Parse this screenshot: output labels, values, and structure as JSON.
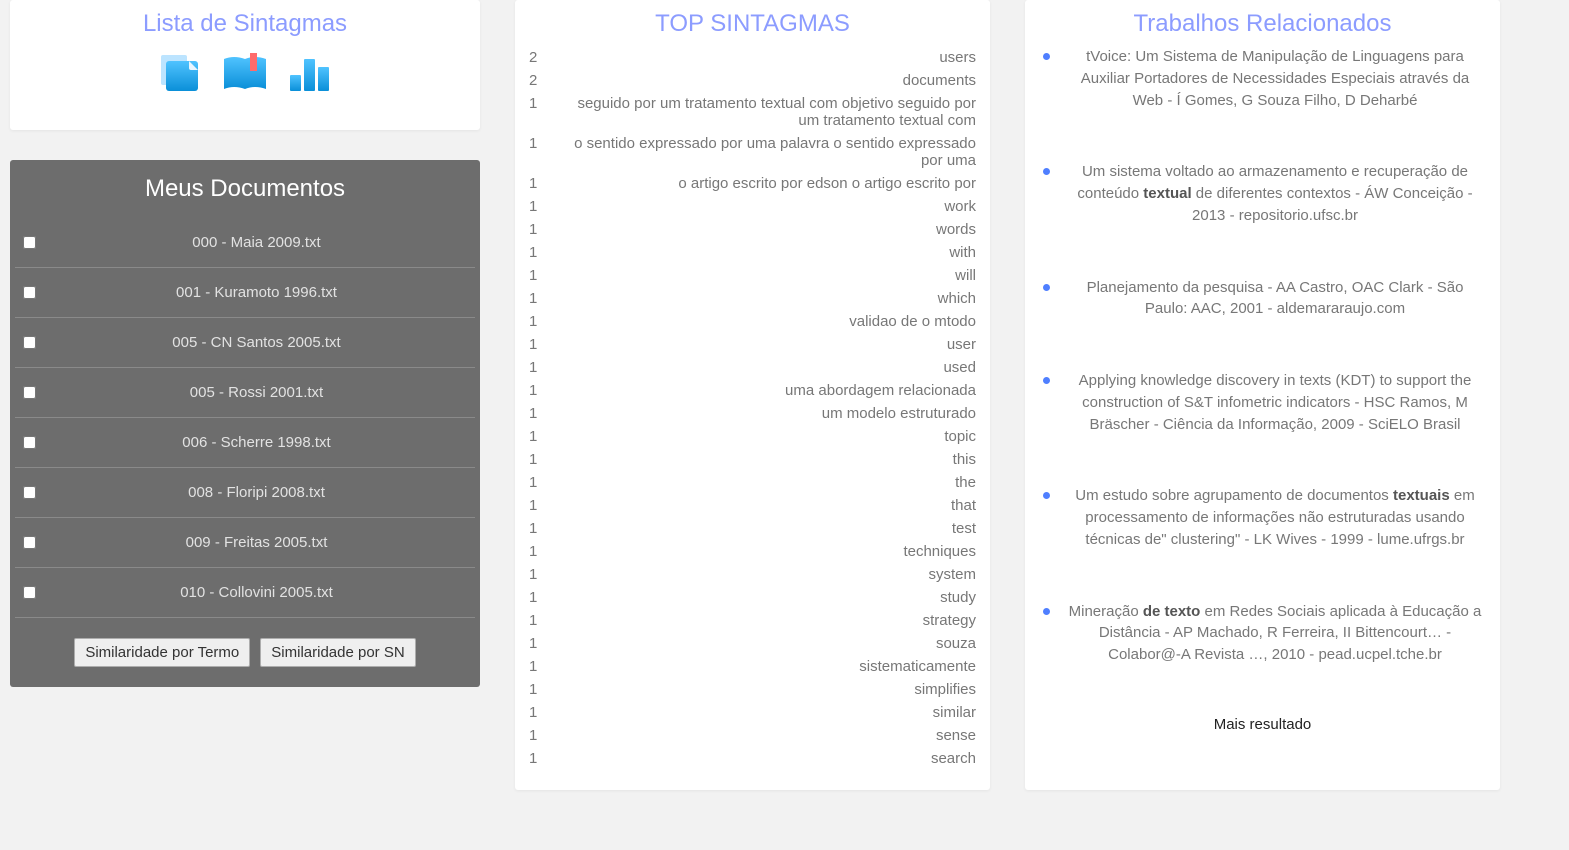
{
  "left": {
    "sintagmas_title": "Lista de Sintagmas",
    "docs_title": "Meus Documentos",
    "documents": [
      "000 - Maia 2009.txt",
      "001 - Kuramoto 1996.txt",
      "005 - CN Santos 2005.txt",
      "005 - Rossi 2001.txt",
      "006 - Scherre 1998.txt",
      "008 - Floripi 2008.txt",
      "009 - Freitas 2005.txt",
      "010 - Collovini 2005.txt"
    ],
    "btn_term": "Similaridade por Termo",
    "btn_sn": "Similaridade por SN"
  },
  "mid": {
    "title": "TOP SINTAGMAS",
    "rows": [
      {
        "count": "2",
        "term": "users"
      },
      {
        "count": "2",
        "term": "documents"
      },
      {
        "count": "1",
        "term": "seguido por um tratamento textual com objetivo seguido por um tratamento textual com"
      },
      {
        "count": "1",
        "term": "o sentido expressado por uma palavra o sentido expressado por uma"
      },
      {
        "count": "1",
        "term": "o artigo escrito por edson o artigo escrito por"
      },
      {
        "count": "1",
        "term": "work"
      },
      {
        "count": "1",
        "term": "words"
      },
      {
        "count": "1",
        "term": "with"
      },
      {
        "count": "1",
        "term": "will"
      },
      {
        "count": "1",
        "term": "which"
      },
      {
        "count": "1",
        "term": "validao de o mtodo"
      },
      {
        "count": "1",
        "term": "user"
      },
      {
        "count": "1",
        "term": "used"
      },
      {
        "count": "1",
        "term": "uma abordagem relacionada"
      },
      {
        "count": "1",
        "term": "um modelo estruturado"
      },
      {
        "count": "1",
        "term": "topic"
      },
      {
        "count": "1",
        "term": "this"
      },
      {
        "count": "1",
        "term": "the"
      },
      {
        "count": "1",
        "term": "that"
      },
      {
        "count": "1",
        "term": "test"
      },
      {
        "count": "1",
        "term": "techniques"
      },
      {
        "count": "1",
        "term": "system"
      },
      {
        "count": "1",
        "term": "study"
      },
      {
        "count": "1",
        "term": "strategy"
      },
      {
        "count": "1",
        "term": "souza"
      },
      {
        "count": "1",
        "term": "sistematicamente"
      },
      {
        "count": "1",
        "term": "simplifies"
      },
      {
        "count": "1",
        "term": "similar"
      },
      {
        "count": "1",
        "term": "sense"
      },
      {
        "count": "1",
        "term": "search"
      }
    ]
  },
  "right": {
    "title": "Trabalhos Relacionados",
    "items": [
      {
        "pre": "tVoice: Um Sistema de Manipulação de Linguagens para Auxiliar Portadores de Necessidades Especiais através da Web - Í Gomes, G Souza Filho, D Deharbé",
        "bold": "",
        "post": ""
      },
      {
        "pre": "Um sistema voltado ao armazenamento e recuperação de conteúdo ",
        "bold": "textual",
        "post": " de diferentes contextos - ÁW Conceição - 2013 - repositorio.ufsc.br"
      },
      {
        "pre": "Planejamento da pesquisa - AA Castro, OAC Clark - São Paulo: AAC, 2001 - aldemararaujo.com",
        "bold": "",
        "post": ""
      },
      {
        "pre": "Applying knowledge discovery in texts (KDT) to support the construction of S&T infometric indicators - HSC Ramos, M Bräscher - Ciência da Informação, 2009 - SciELO Brasil",
        "bold": "",
        "post": ""
      },
      {
        "pre": "Um estudo sobre agrupamento de documentos ",
        "bold": "textuais",
        "post": " em processamento de informações não estruturadas usando técnicas de\" clustering\" - LK Wives - 1999 - lume.ufrgs.br"
      },
      {
        "pre": "Mineração ",
        "bold": "de texto",
        "post": " em Redes Sociais aplicada à Educação a Distância - AP Machado, R Ferreira, II Bittencourt… - Colabor@-A Revista …, 2010 - pead.ucpel.tche.br"
      }
    ],
    "more": "Mais resultado"
  }
}
